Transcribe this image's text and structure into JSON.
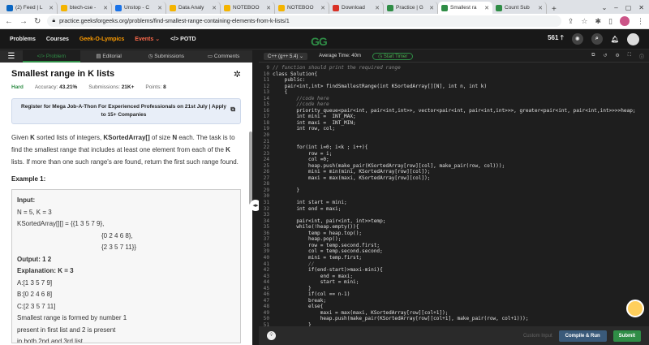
{
  "browser": {
    "tabs": [
      {
        "label": "(2) Feed | L",
        "color": "#0a66c2",
        "active": false
      },
      {
        "label": "btech-cse -",
        "color": "#f4b400",
        "active": false
      },
      {
        "label": "Unstop - C",
        "color": "#1a73e8",
        "active": false
      },
      {
        "label": "Data Analy",
        "color": "#f4b400",
        "active": false
      },
      {
        "label": "NOTEBOO",
        "color": "#f4b400",
        "active": false
      },
      {
        "label": "NOTEBOO",
        "color": "#f4b400",
        "active": false
      },
      {
        "label": "Download",
        "color": "#d93025",
        "active": false
      },
      {
        "label": "Practice | G",
        "color": "#2f8d46",
        "active": false
      },
      {
        "label": "Smallest ra",
        "color": "#2f8d46",
        "active": true
      },
      {
        "label": "Count Sub",
        "color": "#2f8d46",
        "active": false
      }
    ],
    "url": "practice.geeksforgeeks.org/problems/find-smallest-range-containing-elements-from-k-lists/1"
  },
  "gfg_nav": {
    "problems": "Problems",
    "courses": "Courses",
    "geek_o_lympics": "Geek-O-Lympics",
    "events": "Events",
    "potd": "POTD",
    "logo": "GG",
    "streak": "561"
  },
  "left_tabs": [
    "Problem",
    "Editorial",
    "Submissions",
    "Comments"
  ],
  "problem": {
    "title": "Smallest range in K lists",
    "difficulty": "Hard",
    "accuracy_label": "Accuracy:",
    "accuracy": "43.21%",
    "submissions_label": "Submissions:",
    "submissions": "21K+",
    "points_label": "Points:",
    "points": "8",
    "banner": "Register for Mega Job-A-Thon For Experienced Professionals on 21st July | Apply to 15+ Companies",
    "desc_1": "Given ",
    "desc_k": "K",
    "desc_2": " sorted lists of integers, ",
    "desc_arr": "KSortedArray[]",
    "desc_3": " of size ",
    "desc_n": "N",
    "desc_4": " each. The task is to find the smallest range that includes at least one element from each of the ",
    "desc_k2": "K",
    "desc_5": " lists. If more than one such range's are found, return the first such range found.",
    "example_title": "Example 1:",
    "example_lines": [
      "Input:",
      "N = 5, K = 3",
      "KSortedArray[][] = {{1 3 5 7 9},",
      "{0 2 4 6 8},",
      "{2 3 5 7 11}}",
      "Output: 1 2",
      "Explanation: K = 3",
      "A:[1 3 5 7 9]",
      "B:[0 2 4 6 8]",
      "C:[2 3 5 7 11]",
      "Smallest range is formed by number 1",
      "present in first list and 2 is present",
      "in both 2nd and 3rd list."
    ]
  },
  "editor": {
    "language": "C++ (g++ 5.4)",
    "avg_time": "Average Time: 40m",
    "timer": "Start Timer",
    "custom_input": "Custom Input",
    "compile": "Compile & Run",
    "submit": "Submit",
    "lines": [
      {
        "n": "9",
        "t": "// function should print the required range"
      },
      {
        "n": "10",
        "t": "class Solution{"
      },
      {
        "n": "11",
        "t": "    public:"
      },
      {
        "n": "12",
        "t": "    pair<int,int> findSmallestRange(int KSortedArray[][N], int n, int k)"
      },
      {
        "n": "13",
        "t": "    {"
      },
      {
        "n": "14",
        "t": "        //code here"
      },
      {
        "n": "15",
        "t": "        //code here"
      },
      {
        "n": "16",
        "t": "        priority_queue<pair<int, pair<int,int>>, vector<pair<int, pair<int,int>>>, greater<pair<int, pair<int,int>>>>heap;"
      },
      {
        "n": "17",
        "t": "        int mini =  INT_MAX;"
      },
      {
        "n": "18",
        "t": "        int maxi =  INT_MIN;"
      },
      {
        "n": "19",
        "t": "        int row, col;"
      },
      {
        "n": "20",
        "t": ""
      },
      {
        "n": "21",
        "t": ""
      },
      {
        "n": "22",
        "t": "        for(int i=0; i<k ; i++){"
      },
      {
        "n": "23",
        "t": "            row = i;"
      },
      {
        "n": "24",
        "t": "            col =0;"
      },
      {
        "n": "25",
        "t": "            heap.push(make_pair(KSortedArray[row][col], make_pair(row, col)));"
      },
      {
        "n": "26",
        "t": "            mini = min(mini, KSortedArray[row][col]);"
      },
      {
        "n": "27",
        "t": "            maxi = max(maxi, KSortedArray[row][col]);"
      },
      {
        "n": "28",
        "t": ""
      },
      {
        "n": "29",
        "t": "        }"
      },
      {
        "n": "30",
        "t": ""
      },
      {
        "n": "31",
        "t": "        int start = mini;"
      },
      {
        "n": "32",
        "t": "        int end = maxi;"
      },
      {
        "n": "33",
        "t": ""
      },
      {
        "n": "34",
        "t": "        pair<int, pair<int, int>>temp;"
      },
      {
        "n": "35",
        "t": "        while(!heap.empty()){"
      },
      {
        "n": "36",
        "t": "            temp = heap.top();"
      },
      {
        "n": "37",
        "t": "            heap.pop();"
      },
      {
        "n": "38",
        "t": "            row = temp.second.first;"
      },
      {
        "n": "39",
        "t": "            col = temp.second.second;"
      },
      {
        "n": "40",
        "t": "            mini = temp.first;"
      },
      {
        "n": "41",
        "t": "            //"
      },
      {
        "n": "42",
        "t": "            if(end-start)>maxi-mini){"
      },
      {
        "n": "43",
        "t": "                end = maxi;"
      },
      {
        "n": "44",
        "t": "                start = mini;"
      },
      {
        "n": "45",
        "t": "            }"
      },
      {
        "n": "46",
        "t": "            if(col == n-1)"
      },
      {
        "n": "47",
        "t": "            break;"
      },
      {
        "n": "48",
        "t": "            else{"
      },
      {
        "n": "49",
        "t": "                maxi = max(maxi, KSortedArray[row][col+1]);"
      },
      {
        "n": "50",
        "t": "                heap.push(make_pair(KSortedArray[row][col+1], make_pair(row, col+1)));"
      },
      {
        "n": "51",
        "t": "            }"
      }
    ]
  }
}
